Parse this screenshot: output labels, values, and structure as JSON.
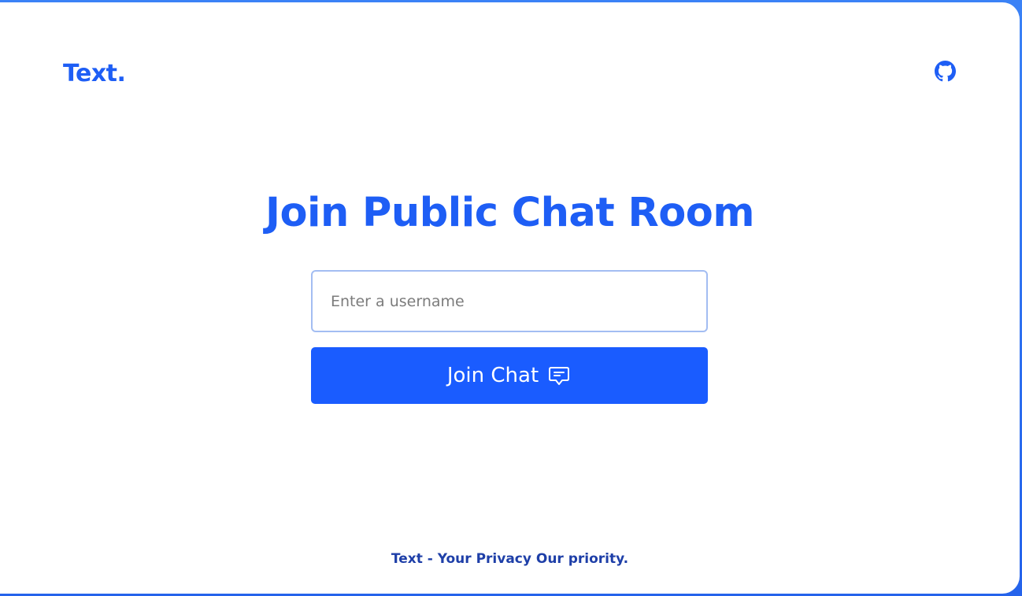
{
  "header": {
    "brand": "Text.",
    "github_icon": "github-icon"
  },
  "main": {
    "title": "Join Public Chat Room",
    "username_input": {
      "placeholder": "Enter a username",
      "value": ""
    },
    "join_button": {
      "label": "Join Chat",
      "icon": "chat-bubble-icon"
    }
  },
  "footer": {
    "text": "Text - Your Privacy Our priority."
  },
  "colors": {
    "accent": "#1a5cff",
    "brand_text": "#1e5ef5",
    "footer_text": "#1e3fa8",
    "input_border": "#a3bdf2",
    "background_gradient": "#3b82f6"
  }
}
